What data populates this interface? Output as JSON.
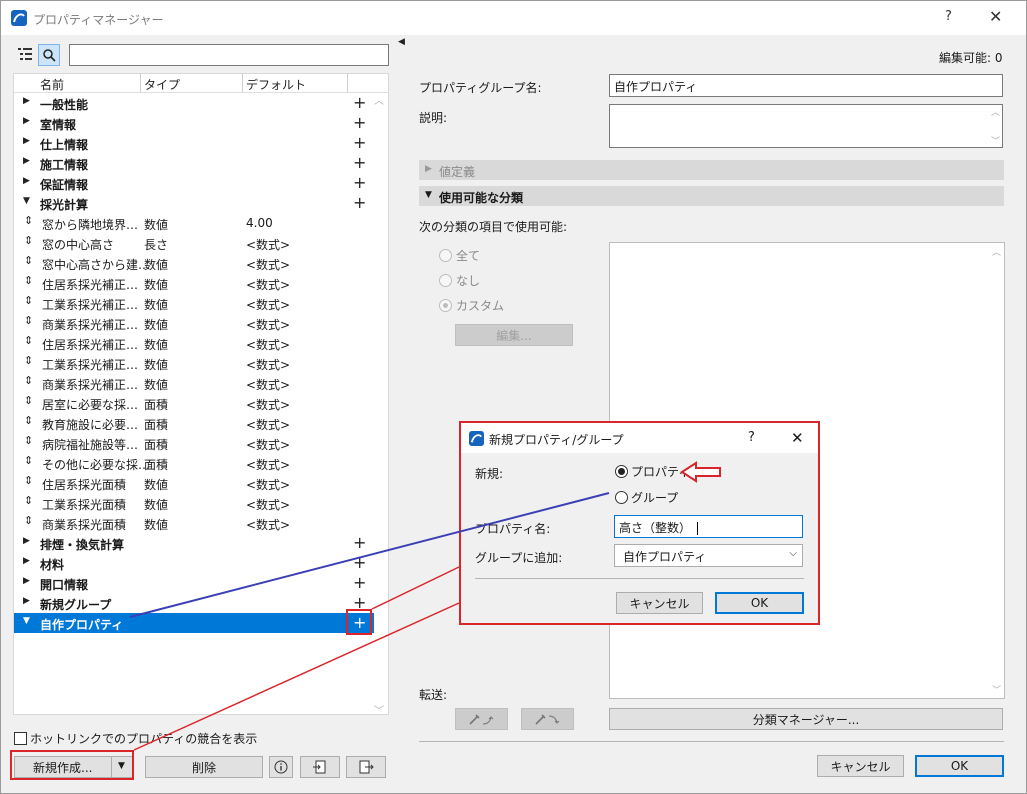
{
  "window": {
    "title": "プロパティマネージャー",
    "help": "?",
    "close": "✕"
  },
  "left": {
    "columns": {
      "name": "名前",
      "type": "タイプ",
      "default": "デフォルト"
    },
    "groups_top": [
      {
        "name": "一般性能"
      },
      {
        "name": "室情報"
      },
      {
        "name": "仕上情報"
      },
      {
        "name": "施工情報"
      },
      {
        "name": "保証情報"
      }
    ],
    "expanded_group": {
      "name": "採光計算"
    },
    "properties": [
      {
        "name": "窓から隣地境界…",
        "type": "数値",
        "default": "4.00"
      },
      {
        "name": "窓の中心高さ",
        "type": "長さ",
        "default": "<数式>"
      },
      {
        "name": "窓中心高さから建…",
        "type": "数値",
        "default": "<数式>"
      },
      {
        "name": "住居系採光補正…",
        "type": "数値",
        "default": "<数式>"
      },
      {
        "name": "工業系採光補正…",
        "type": "数値",
        "default": "<数式>"
      },
      {
        "name": "商業系採光補正…",
        "type": "数値",
        "default": "<数式>"
      },
      {
        "name": "住居系採光補正…",
        "type": "数値",
        "default": "<数式>"
      },
      {
        "name": "工業系採光補正…",
        "type": "数値",
        "default": "<数式>"
      },
      {
        "name": "商業系採光補正…",
        "type": "数値",
        "default": "<数式>"
      },
      {
        "name": "居室に必要な採…",
        "type": "面積",
        "default": "<数式>"
      },
      {
        "name": "教育施設に必要…",
        "type": "面積",
        "default": "<数式>"
      },
      {
        "name": "病院福祉施設等…",
        "type": "面積",
        "default": "<数式>"
      },
      {
        "name": "その他に必要な採…",
        "type": "面積",
        "default": "<数式>"
      },
      {
        "name": "住居系採光面積",
        "type": "数値",
        "default": "<数式>"
      },
      {
        "name": "工業系採光面積",
        "type": "数値",
        "default": "<数式>"
      },
      {
        "name": "商業系採光面積",
        "type": "数値",
        "default": "<数式>"
      }
    ],
    "groups_bottom": [
      {
        "name": "排煙・換気計算"
      },
      {
        "name": "材料"
      },
      {
        "name": "開口情報"
      },
      {
        "name": "新規グループ"
      }
    ],
    "selected_group": {
      "name": "自作プロパティ"
    },
    "hotlink_checkbox": "ホットリンクでのプロパティの競合を表示",
    "new_button": "新規作成...",
    "delete_button": "削除"
  },
  "right": {
    "editable": "編集可能: 0",
    "group_name_label": "プロパティグループ名:",
    "group_name_value": "自作プロパティ",
    "description_label": "説明:",
    "value_def_section": "値定義",
    "classification_section": "使用可能な分類",
    "available_label": "次の分類の項目で使用可能:",
    "radio_all": "全て",
    "radio_none": "なし",
    "radio_custom": "カスタム",
    "edit_button": "編集...",
    "transfer_label": "転送:",
    "class_manager_button": "分類マネージャー...",
    "cancel": "キャンセル",
    "ok": "OK"
  },
  "dialog": {
    "title": "新規プロパティ/グループ",
    "help": "?",
    "close": "✕",
    "new_label": "新規:",
    "radio_property": "プロパティ",
    "radio_group": "グループ",
    "prop_name_label": "プロパティ名:",
    "prop_name_value": "高さ（整数）",
    "add_to_group_label": "グループに追加:",
    "add_to_group_value": "自作プロパティ",
    "cancel": "キャンセル",
    "ok": "OK"
  },
  "colors": {
    "selection": "#0078d7",
    "annotation_red": "#d9262b",
    "annotation_blue": "#3a3fb5"
  }
}
